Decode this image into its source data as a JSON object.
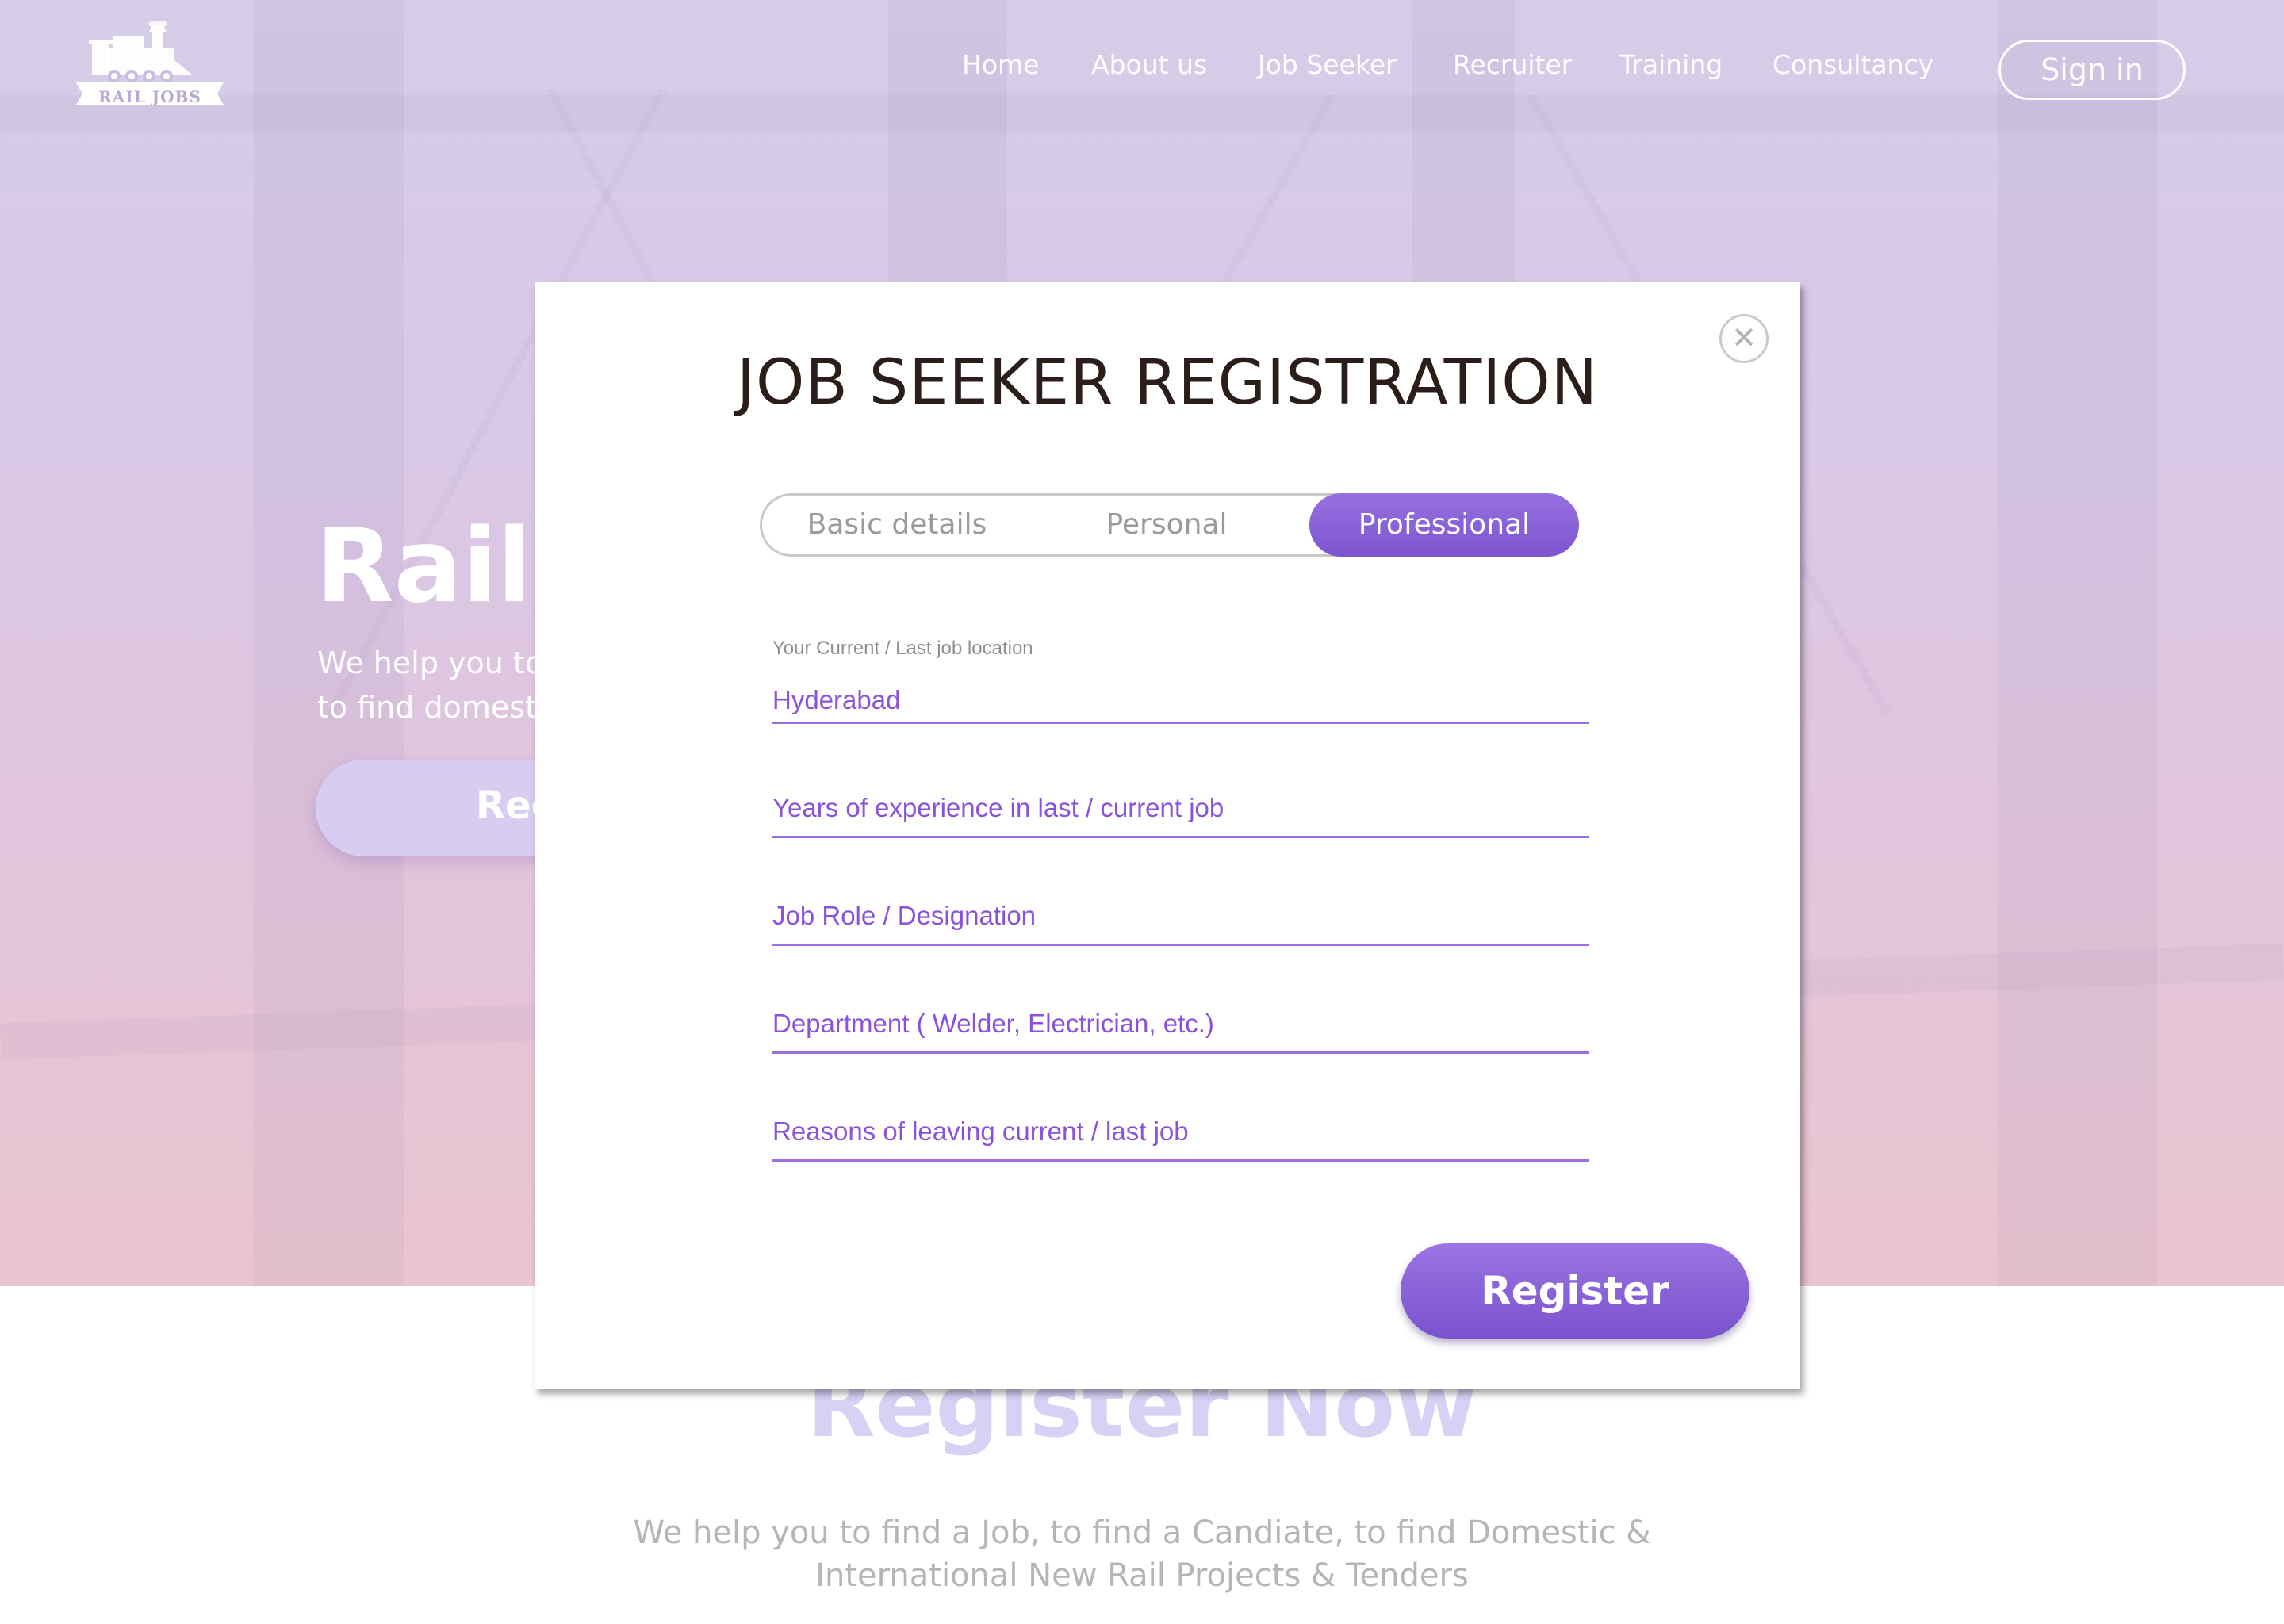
{
  "header": {
    "logo_text": "RAIL JOBS",
    "nav": {
      "home": "Home",
      "about": "About us",
      "job_seeker": "Job Seeker",
      "recruiter": "Recruiter",
      "training": "Training",
      "consultancy": "Consultancy"
    },
    "signin_label": "Sign in"
  },
  "hero": {
    "title": "Rail J",
    "subtitle_line1": "We help you to",
    "subtitle_line2": "to find domesti",
    "cta_label": "Reg"
  },
  "section": {
    "title": "Register Now",
    "description": "We help you to find a Job, to find a Candiate, to find Domestic & International New Rail Projects & Tenders"
  },
  "modal": {
    "close_glyph": "✕",
    "title": "JOB SEEKER REGISTRATION",
    "steps": {
      "basic": "Basic details",
      "personal": "Personal",
      "professional": "Professional",
      "active": "Professional"
    },
    "fields": {
      "location_label": "Your Current / Last job location",
      "location_value": "Hyderabad",
      "years_placeholder": "Years of experience in last / current job",
      "role_placeholder": "Job Role / Designation",
      "department_placeholder": "Department ( Welder, Electrician, etc.)",
      "reason_placeholder": "Reasons of leaving current / last job"
    },
    "register_label": "Register"
  },
  "colors": {
    "accent": "#8a52db",
    "button_purple": "#7d55cf",
    "title_dark": "#2b1d1a"
  },
  "icons": {
    "logo": "train-locomotive-icon",
    "close": "close-icon"
  }
}
